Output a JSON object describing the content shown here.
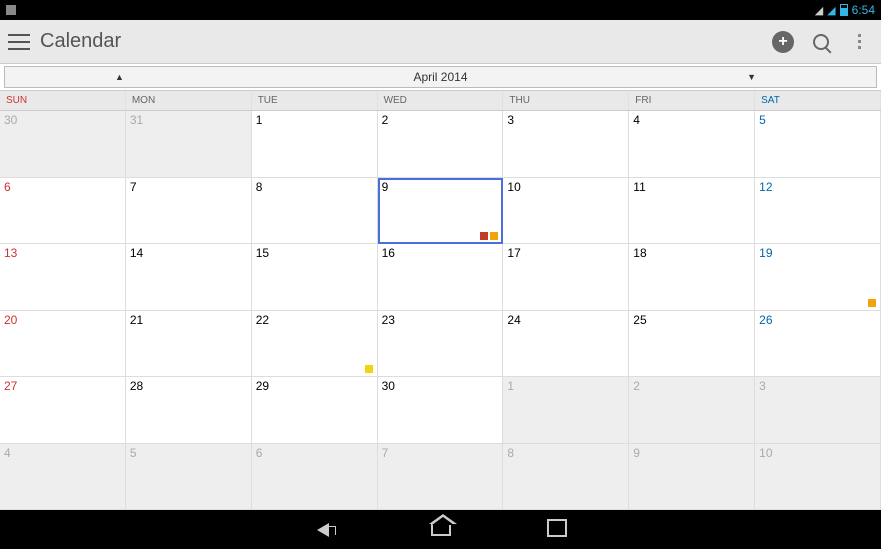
{
  "statusbar": {
    "time": "6:54"
  },
  "actionbar": {
    "title": "Calendar"
  },
  "month_selector": {
    "label": "April 2014"
  },
  "day_headers": [
    "SUN",
    "MON",
    "TUE",
    "WED",
    "THU",
    "FRI",
    "SAT"
  ],
  "colors": {
    "red": "#c0392b",
    "orange": "#f1a30b",
    "yellow": "#f1d40b"
  },
  "weeks": [
    [
      {
        "n": "30",
        "other": true
      },
      {
        "n": "31",
        "other": true
      },
      {
        "n": "1"
      },
      {
        "n": "2"
      },
      {
        "n": "3"
      },
      {
        "n": "4"
      },
      {
        "n": "5"
      }
    ],
    [
      {
        "n": "6"
      },
      {
        "n": "7"
      },
      {
        "n": "8"
      },
      {
        "n": "9",
        "today": true,
        "marks": [
          "red",
          "orange"
        ]
      },
      {
        "n": "10"
      },
      {
        "n": "11"
      },
      {
        "n": "12"
      }
    ],
    [
      {
        "n": "13"
      },
      {
        "n": "14"
      },
      {
        "n": "15"
      },
      {
        "n": "16"
      },
      {
        "n": "17"
      },
      {
        "n": "18"
      },
      {
        "n": "19",
        "marks": [
          "orange"
        ]
      }
    ],
    [
      {
        "n": "20"
      },
      {
        "n": "21"
      },
      {
        "n": "22",
        "marks": [
          "yellow"
        ]
      },
      {
        "n": "23"
      },
      {
        "n": "24"
      },
      {
        "n": "25"
      },
      {
        "n": "26"
      }
    ],
    [
      {
        "n": "27"
      },
      {
        "n": "28"
      },
      {
        "n": "29"
      },
      {
        "n": "30"
      },
      {
        "n": "1",
        "other": true
      },
      {
        "n": "2",
        "other": true
      },
      {
        "n": "3",
        "other": true
      }
    ],
    [
      {
        "n": "4",
        "other": true
      },
      {
        "n": "5",
        "other": true
      },
      {
        "n": "6",
        "other": true
      },
      {
        "n": "7",
        "other": true
      },
      {
        "n": "8",
        "other": true
      },
      {
        "n": "9",
        "other": true
      },
      {
        "n": "10",
        "other": true
      }
    ]
  ]
}
